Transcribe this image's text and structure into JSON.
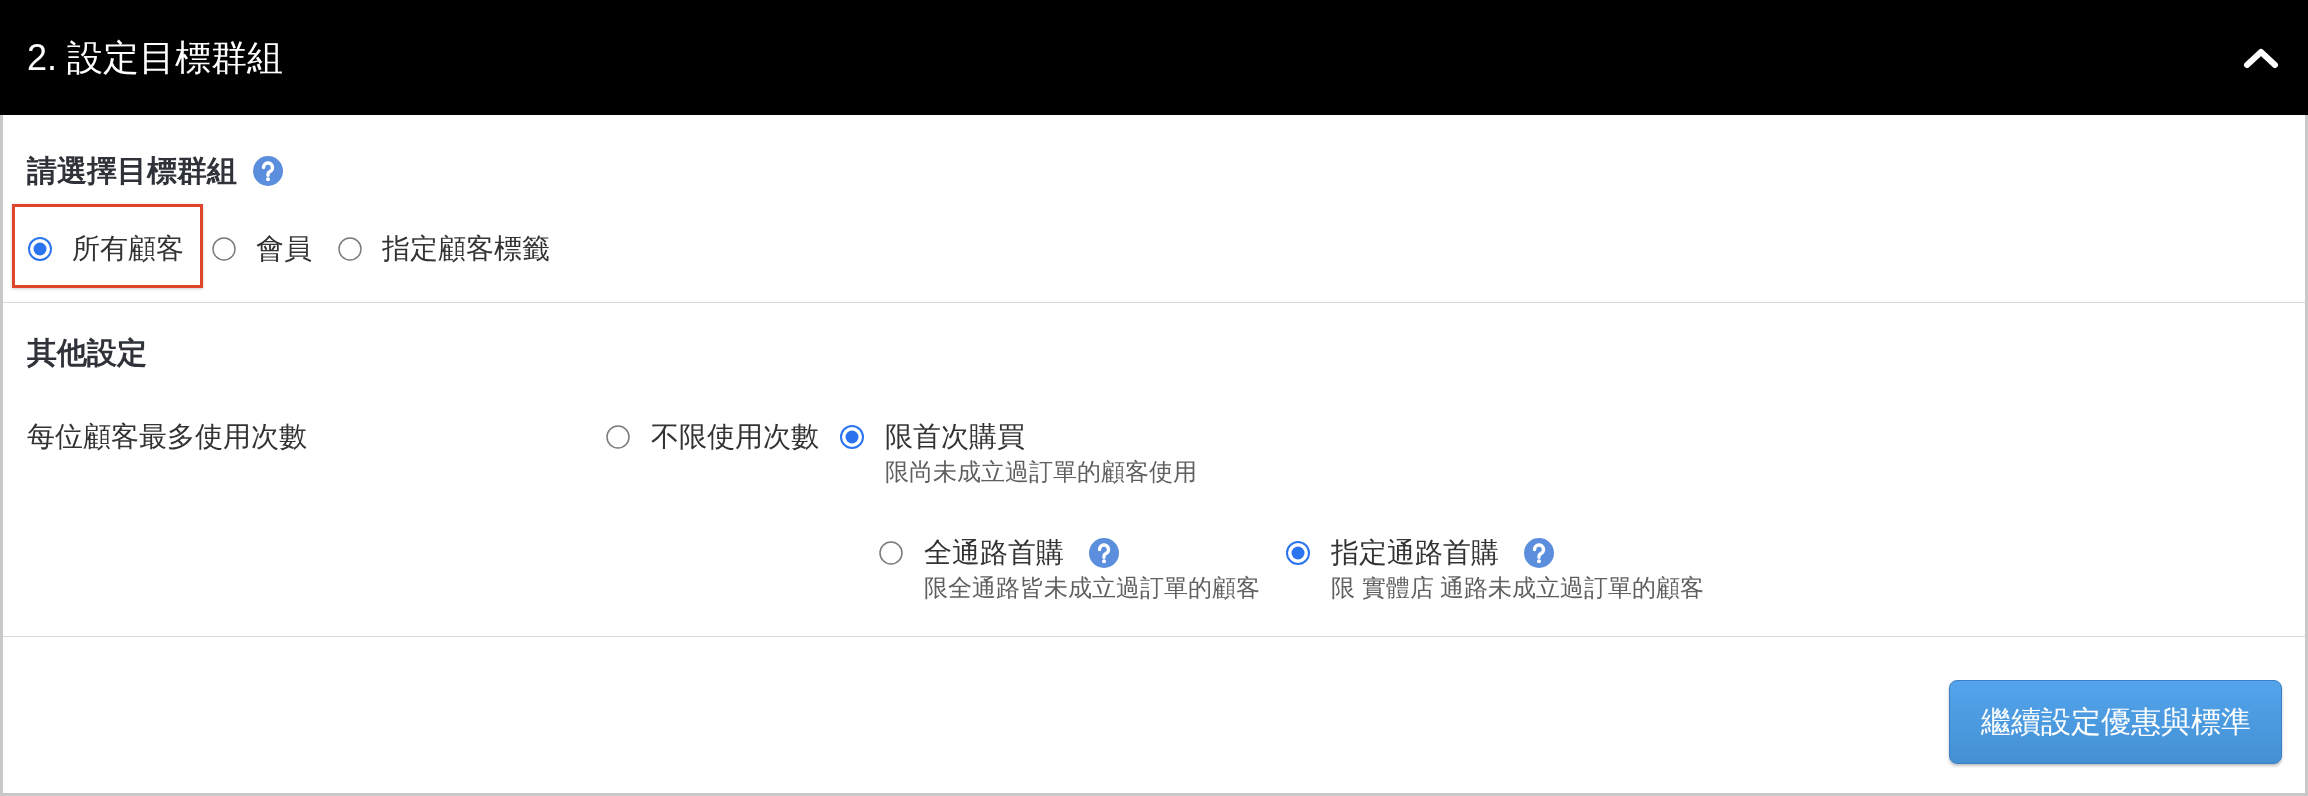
{
  "header": {
    "title": "2. 設定目標群組",
    "expanded": true
  },
  "target_group": {
    "heading": "請選擇目標群組",
    "help": true,
    "options": [
      {
        "label": "所有顧客",
        "selected": true,
        "highlighted": true
      },
      {
        "label": "會員",
        "selected": false,
        "highlighted": false
      },
      {
        "label": "指定顧客標籤",
        "selected": false,
        "highlighted": false
      }
    ]
  },
  "other_settings": {
    "heading": "其他設定",
    "rows": [
      {
        "label": "每位顧客最多使用次數",
        "options": [
          {
            "label": "不限使用次數",
            "selected": false
          },
          {
            "label": "限首次購買",
            "selected": true,
            "description": "限尚未成立過訂單的顧客使用",
            "children": [
              {
                "label": "全通路首購",
                "selected": false,
                "help": true,
                "description": "限全通路皆未成立過訂單的顧客"
              },
              {
                "label": "指定通路首購",
                "selected": true,
                "help": true,
                "description": "限 實體店 通路未成立過訂單的顧客"
              }
            ]
          }
        ]
      }
    ]
  },
  "button": {
    "label": "繼續設定優惠與標準"
  }
}
